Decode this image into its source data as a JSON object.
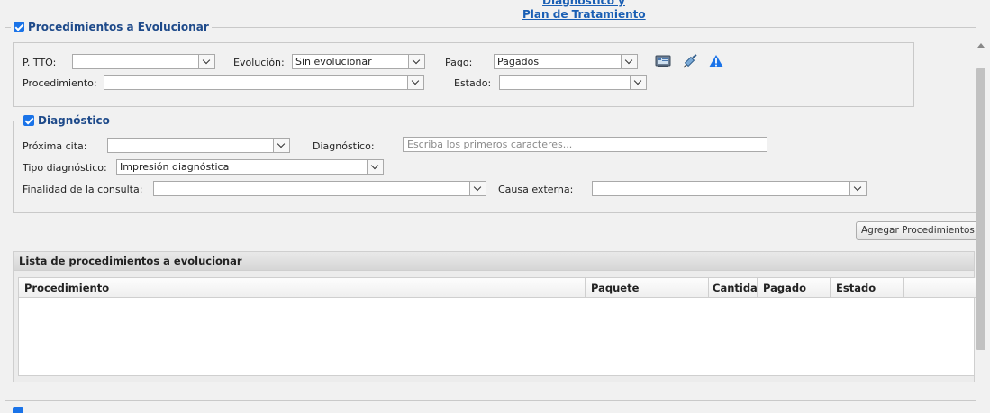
{
  "header": {
    "top_link_partial": "Diagnóstico y",
    "top_link": "Plan de Tratamiento"
  },
  "procedimientos": {
    "legend": "Procedimientos a Evolucionar",
    "p_tto_label": "P. TTO:",
    "p_tto_value": "",
    "evolucion_label": "Evolución:",
    "evolucion_value": "Sin evolucionar",
    "pago_label": "Pago:",
    "pago_value": "Pagados",
    "procedimiento_label": "Procedimiento:",
    "procedimiento_value": "",
    "estado_label": "Estado:",
    "estado_value": ""
  },
  "diagnostico": {
    "legend": "Diagnóstico",
    "proxima_cita_label": "Próxima cita:",
    "proxima_cita_value": "",
    "diagnostico_label": "Diagnóstico:",
    "diagnostico_placeholder": "Escriba los primeros caracteres...",
    "tipo_label": "Tipo diagnóstico:",
    "tipo_value": "Impresión diagnóstica",
    "finalidad_label": "Finalidad de la consulta:",
    "finalidad_value": "",
    "causa_label": "Causa externa:",
    "causa_value": ""
  },
  "actions": {
    "agregar_label": "Agregar Procedimientos"
  },
  "lista": {
    "title": "Lista de procedimientos a evolucionar",
    "columns": [
      "Procedimiento",
      "Paquete",
      "Cantidad",
      "Pagado",
      "Estado"
    ],
    "rows": []
  },
  "icons": [
    "monitor-icon",
    "syringe-icon",
    "warning-icon"
  ],
  "colors": {
    "link": "#1a5fb4",
    "legend": "#1e4a8a",
    "checkbox": "#1a73e8",
    "warning": "#1a73e8"
  }
}
